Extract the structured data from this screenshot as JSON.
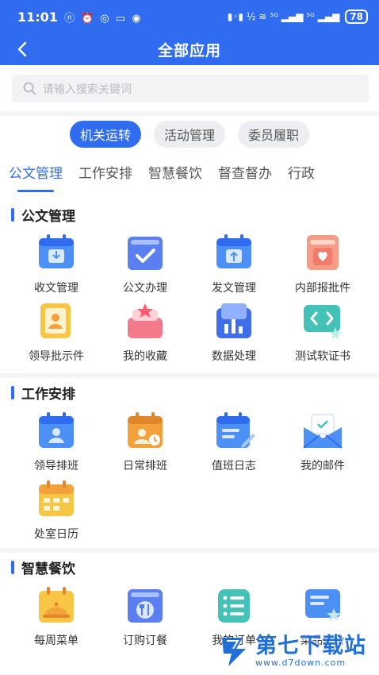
{
  "status_bar": {
    "time": "11:01",
    "left_icons": "ⓝ ⏰ ◎ ▭ ◉",
    "right_icons": "▮◦▮  ½ ≋ ⁵ᴳ ▂▄▆ ⁵ᴳ ▂▄▆",
    "battery": "78"
  },
  "header": {
    "title": "全部应用"
  },
  "search": {
    "placeholder": "请输入搜索关键词"
  },
  "category_pills": [
    "机关运转",
    "活动管理",
    "委员履职"
  ],
  "tabs": [
    "公文管理",
    "工作安排",
    "智慧餐饮",
    "督查督办",
    "行政"
  ],
  "sections": [
    {
      "title": "公文管理",
      "items": [
        {
          "label": "收文管理",
          "icon": "inbox-calendar-icon"
        },
        {
          "label": "公文办理",
          "icon": "check-document-icon"
        },
        {
          "label": "发文管理",
          "icon": "outbox-calendar-icon"
        },
        {
          "label": "内部报批件",
          "icon": "heart-file-icon"
        },
        {
          "label": "领导批示件",
          "icon": "leader-document-icon"
        },
        {
          "label": "我的收藏",
          "icon": "star-box-icon"
        },
        {
          "label": "数据处理",
          "icon": "chart-folder-icon"
        },
        {
          "label": "测试软证书",
          "icon": "code-certificate-icon"
        }
      ]
    },
    {
      "title": "工作安排",
      "items": [
        {
          "label": "领导排班",
          "icon": "leader-calendar-icon"
        },
        {
          "label": "日常排班",
          "icon": "clock-calendar-icon"
        },
        {
          "label": "值班日志",
          "icon": "pen-log-icon"
        },
        {
          "label": "我的邮件",
          "icon": "mail-envelope-icon"
        },
        {
          "label": "处室日历",
          "icon": "office-calendar-icon"
        }
      ]
    },
    {
      "title": "智慧餐饮",
      "items": [
        {
          "label": "每周菜单",
          "icon": "dish-cover-icon"
        },
        {
          "label": "订购订餐",
          "icon": "cutlery-order-icon"
        },
        {
          "label": "我的订单",
          "icon": "list-order-icon"
        },
        {
          "label": "菜品评价",
          "icon": "star-rating-icon"
        }
      ]
    }
  ],
  "watermark": {
    "text": "第七下载站",
    "url": "www.d7down.com"
  },
  "colors": {
    "brand_blue": "#2f6cf0",
    "icon_blue": "#4d90f5",
    "icon_orange": "#f4a13c",
    "icon_yellow": "#f6c644",
    "icon_red": "#f27a6a",
    "icon_teal": "#45c2b8"
  }
}
